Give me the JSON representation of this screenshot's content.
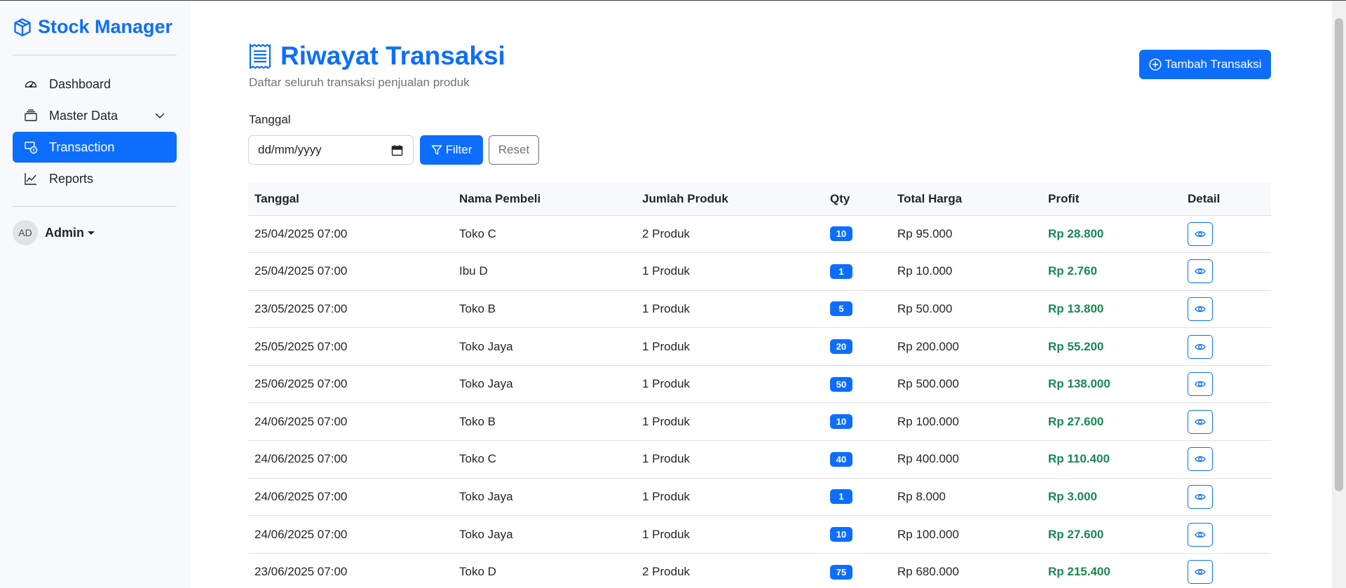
{
  "sidebar": {
    "brand": "Stock Manager",
    "items": [
      {
        "label": "Dashboard",
        "icon": "speedometer-icon"
      },
      {
        "label": "Master Data",
        "icon": "box-stack-icon"
      },
      {
        "label": "Transaction",
        "icon": "cash-coin-icon",
        "active": true
      },
      {
        "label": "Reports",
        "icon": "graph-up-icon"
      }
    ],
    "user": {
      "initials": "AD",
      "name": "Admin"
    }
  },
  "header": {
    "title": "Riwayat Transaksi",
    "subtitle": "Daftar seluruh transaksi penjualan produk",
    "add_button": "Tambah Transaksi"
  },
  "filter": {
    "label": "Tanggal",
    "date_placeholder": "dd/mm/yyyy",
    "filter_button": "Filter",
    "reset_button": "Reset"
  },
  "table": {
    "columns": [
      "Tanggal",
      "Nama Pembeli",
      "Jumlah Produk",
      "Qty",
      "Total Harga",
      "Profit",
      "Detail"
    ],
    "rows": [
      {
        "tanggal": "25/04/2025 07:00",
        "pembeli": "Toko C",
        "jumlah": "2 Produk",
        "qty": "10",
        "total": "Rp 95.000",
        "profit": "Rp 28.800"
      },
      {
        "tanggal": "25/04/2025 07:00",
        "pembeli": "Ibu D",
        "jumlah": "1 Produk",
        "qty": "1",
        "total": "Rp 10.000",
        "profit": "Rp 2.760"
      },
      {
        "tanggal": "23/05/2025 07:00",
        "pembeli": "Toko B",
        "jumlah": "1 Produk",
        "qty": "5",
        "total": "Rp 50.000",
        "profit": "Rp 13.800"
      },
      {
        "tanggal": "25/05/2025 07:00",
        "pembeli": "Toko Jaya",
        "jumlah": "1 Produk",
        "qty": "20",
        "total": "Rp 200.000",
        "profit": "Rp 55.200"
      },
      {
        "tanggal": "25/06/2025 07:00",
        "pembeli": "Toko Jaya",
        "jumlah": "1 Produk",
        "qty": "50",
        "total": "Rp 500.000",
        "profit": "Rp 138.000"
      },
      {
        "tanggal": "24/06/2025 07:00",
        "pembeli": "Toko B",
        "jumlah": "1 Produk",
        "qty": "10",
        "total": "Rp 100.000",
        "profit": "Rp 27.600"
      },
      {
        "tanggal": "24/06/2025 07:00",
        "pembeli": "Toko C",
        "jumlah": "1 Produk",
        "qty": "40",
        "total": "Rp 400.000",
        "profit": "Rp 110.400"
      },
      {
        "tanggal": "24/06/2025 07:00",
        "pembeli": "Toko Jaya",
        "jumlah": "1 Produk",
        "qty": "1",
        "total": "Rp 8.000",
        "profit": "Rp 3.000"
      },
      {
        "tanggal": "24/06/2025 07:00",
        "pembeli": "Toko Jaya",
        "jumlah": "1 Produk",
        "qty": "10",
        "total": "Rp 100.000",
        "profit": "Rp 27.600"
      },
      {
        "tanggal": "23/06/2025 07:00",
        "pembeli": "Toko D",
        "jumlah": "2 Produk",
        "qty": "75",
        "total": "Rp 680.000",
        "profit": "Rp 215.400"
      }
    ]
  },
  "colors": {
    "primary": "#0d6efd",
    "profit": "#198754",
    "sidebar_bg": "#f8f9fa"
  }
}
